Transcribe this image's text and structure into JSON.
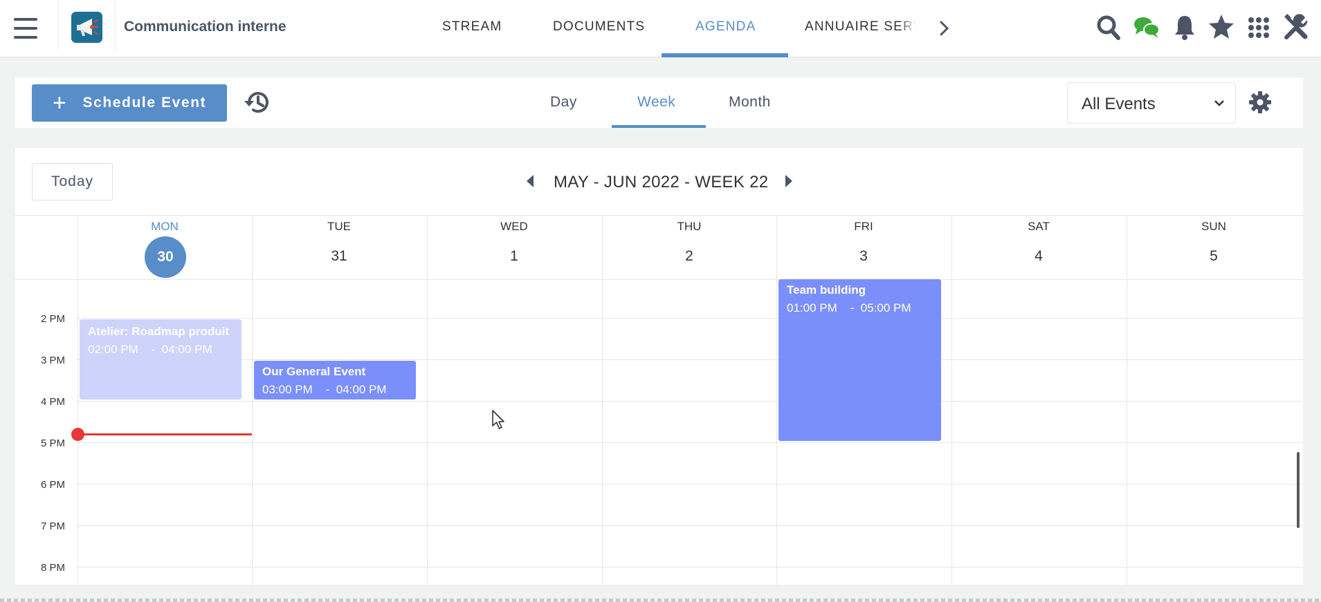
{
  "topbar": {
    "space_title": "Communication interne",
    "nav_tabs": [
      {
        "label": "STREAM"
      },
      {
        "label": "DOCUMENTS"
      },
      {
        "label": "AGENDA",
        "active": true
      },
      {
        "label": "ANNUAIRE SERV"
      }
    ],
    "icons": [
      "search-icon",
      "chat-icon",
      "bell-icon",
      "star-icon",
      "apps-grid-icon",
      "admin-tools-icon"
    ],
    "accent_color": "#578dc9",
    "chat_color": "#3daa3a"
  },
  "actionbar": {
    "schedule_label": "Schedule Event",
    "view_tabs": [
      {
        "label": "Day"
      },
      {
        "label": "Week",
        "active": true
      },
      {
        "label": "Month"
      }
    ],
    "filter_value": "All Events"
  },
  "calendar": {
    "today_label": "Today",
    "title": "MAY - JUN 2022 - WEEK 22",
    "days": [
      {
        "name": "MON",
        "num": "30",
        "today": true
      },
      {
        "name": "TUE",
        "num": "31"
      },
      {
        "name": "WED",
        "num": "1"
      },
      {
        "name": "THU",
        "num": "2"
      },
      {
        "name": "FRI",
        "num": "3"
      },
      {
        "name": "SAT",
        "num": "4"
      },
      {
        "name": "SUN",
        "num": "5"
      }
    ],
    "hours": [
      "2 PM",
      "3 PM",
      "4 PM",
      "5 PM",
      "6 PM",
      "7 PM",
      "8 PM"
    ],
    "events": [
      {
        "title": "Atelier: Roadmap produit",
        "time": "02:00 PM    -  04:00 PM",
        "day": "MON",
        "color": "#cdd3fb"
      },
      {
        "title": "Our General Event",
        "time": "03:00 PM    -  04:00 PM",
        "day": "TUE",
        "color": "#7b8ffb"
      },
      {
        "title": "Team building",
        "time": "01:00 PM    -  05:00 PM",
        "day": "FRI",
        "color": "#7b8ffb"
      }
    ],
    "now_indicator_color": "#e53935"
  }
}
